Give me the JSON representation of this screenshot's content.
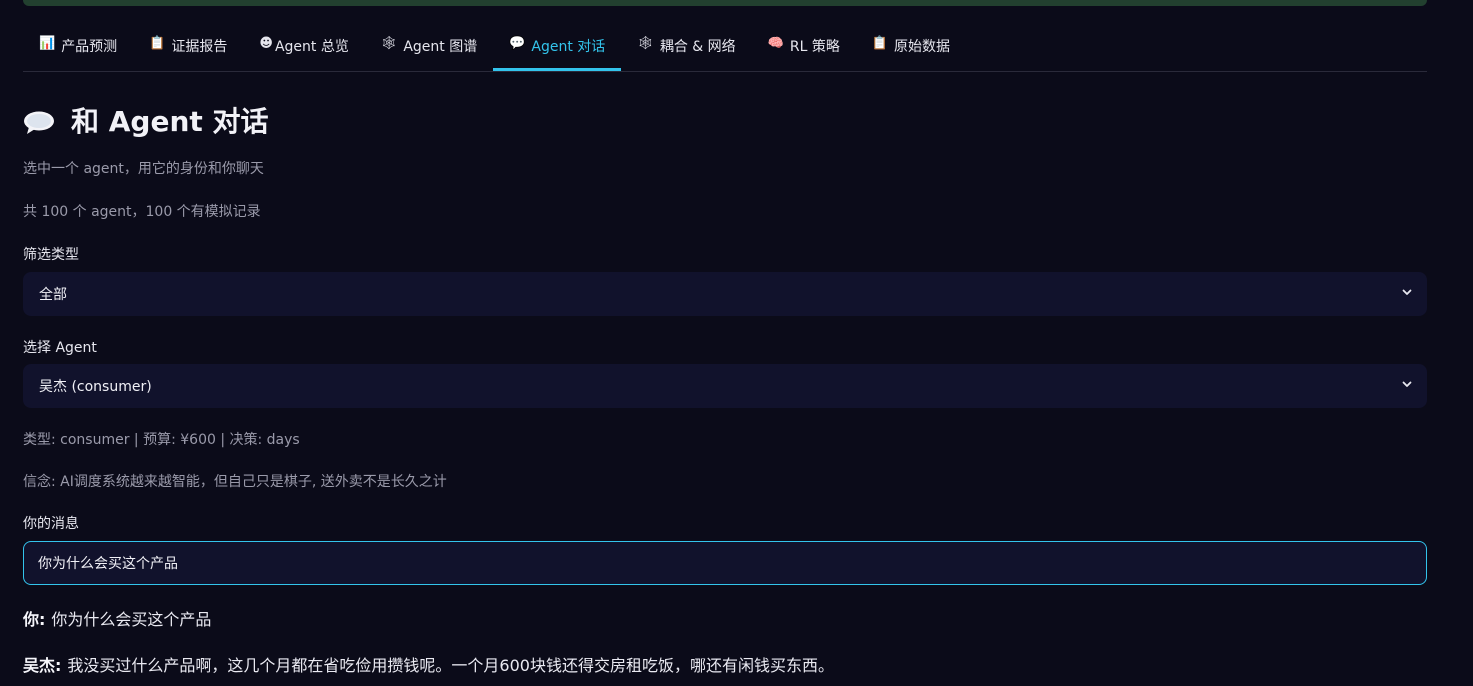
{
  "tabs": [
    {
      "icon": "📊",
      "label": "产品预测"
    },
    {
      "icon": "📋",
      "label": "证据报告"
    },
    {
      "icon": "☻",
      "label": "Agent 总览"
    },
    {
      "icon": "🕸",
      "label": "Agent 图谱"
    },
    {
      "icon": "💬",
      "label": "Agent 对话"
    },
    {
      "icon": "🕸",
      "label": "耦合 & 网络"
    },
    {
      "icon": "🧠",
      "label": "RL 策略"
    },
    {
      "icon": "📋",
      "label": "原始数据"
    }
  ],
  "active_tab_index": 4,
  "page": {
    "title": "和 Agent 对话",
    "subtitle": "选中一个 agent，用它的身份和你聊天",
    "summary": "共 100 个 agent，100 个有模拟记录"
  },
  "filter": {
    "label": "筛选类型",
    "selected": "全部"
  },
  "agent_select": {
    "label": "选择 Agent",
    "selected": "吴杰 (consumer)"
  },
  "agent_info": {
    "meta": "类型: consumer | 预算: ¥600 | 决策: days",
    "belief": "信念: AI调度系统越来越智能，但自己只是棋子, 送外卖不是长久之计"
  },
  "message_input": {
    "label": "你的消息",
    "value": "你为什么会买这个产品"
  },
  "chat": [
    {
      "speaker": "你:",
      "text": "你为什么会买这个产品"
    },
    {
      "speaker": "吴杰:",
      "text": "我没买过什么产品啊，这几个月都在省吃俭用攒钱呢。一个月600块钱还得交房租吃饭，哪还有闲钱买东西。"
    }
  ],
  "colors": {
    "accent": "#33c4ec",
    "background": "#0b0b19",
    "field": "#11122c",
    "top_bar": "#22402f"
  }
}
